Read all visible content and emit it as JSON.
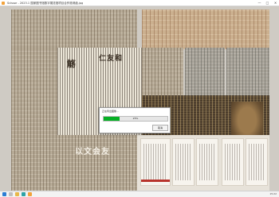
{
  "window": {
    "title": "Scissor - 2023.1 国家图书馆数字展览馆项目合作邀请函.jpg",
    "minimize": "—",
    "maximize": "□",
    "close": "✕"
  },
  "viewer": {
    "artwork_chars": {
      "center_top": "仁友和",
      "center_side": "觞",
      "bottom_left": "以文会友"
    }
  },
  "dialog": {
    "title": "正在导出图像...",
    "progress_percent": 25,
    "progress_label": "25%",
    "cancel_label": "取消"
  },
  "taskbar": {
    "icons": [
      "windows-icon",
      "search-icon",
      "file-explorer-icon",
      "edge-browser-icon",
      "app-icon"
    ],
    "clock": "15:22"
  },
  "colors": {
    "progress": "#06b025",
    "accent_red": "#b8342c"
  }
}
